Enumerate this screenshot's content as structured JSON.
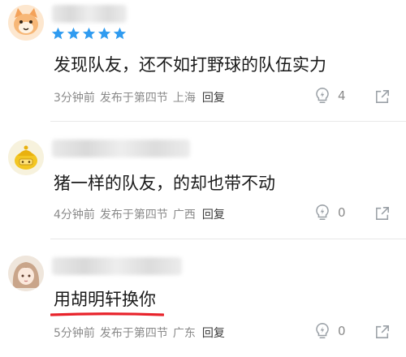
{
  "comments": [
    {
      "avatar_icon": "cartoon-face-avatar",
      "stars": 5,
      "text": "发现队友，还不如打野球的队伍实力",
      "time": "3分钟前",
      "posted_in": "发布于第四节",
      "location": "上海",
      "reply_label": "回复",
      "likes": "4"
    },
    {
      "avatar_icon": "yellow-hat-avatar",
      "text": "猪一样的队友，的却也带不动",
      "time": "4分钟前",
      "posted_in": "发布于第四节",
      "location": "广西",
      "reply_label": "回复",
      "likes": "0"
    },
    {
      "avatar_icon": "anime-girl-avatar",
      "text": "用胡明轩换你",
      "time": "5分钟前",
      "posted_in": "发布于第四节",
      "location": "广东",
      "reply_label": "回复",
      "likes": "0"
    }
  ],
  "colors": {
    "star": "#2f9bf0",
    "underline": "#e8222a",
    "meta_text": "#8a8a8a",
    "icon": "#9aa0a6"
  }
}
